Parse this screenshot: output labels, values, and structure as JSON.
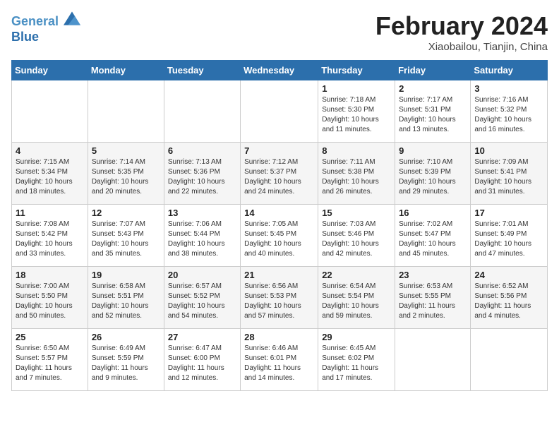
{
  "header": {
    "logo_line1": "General",
    "logo_line2": "Blue",
    "month_title": "February 2024",
    "location": "Xiaobailou, Tianjin, China"
  },
  "days_of_week": [
    "Sunday",
    "Monday",
    "Tuesday",
    "Wednesday",
    "Thursday",
    "Friday",
    "Saturday"
  ],
  "weeks": [
    [
      {
        "day": "",
        "info": ""
      },
      {
        "day": "",
        "info": ""
      },
      {
        "day": "",
        "info": ""
      },
      {
        "day": "",
        "info": ""
      },
      {
        "day": "1",
        "info": "Sunrise: 7:18 AM\nSunset: 5:30 PM\nDaylight: 10 hours\nand 11 minutes."
      },
      {
        "day": "2",
        "info": "Sunrise: 7:17 AM\nSunset: 5:31 PM\nDaylight: 10 hours\nand 13 minutes."
      },
      {
        "day": "3",
        "info": "Sunrise: 7:16 AM\nSunset: 5:32 PM\nDaylight: 10 hours\nand 16 minutes."
      }
    ],
    [
      {
        "day": "4",
        "info": "Sunrise: 7:15 AM\nSunset: 5:34 PM\nDaylight: 10 hours\nand 18 minutes."
      },
      {
        "day": "5",
        "info": "Sunrise: 7:14 AM\nSunset: 5:35 PM\nDaylight: 10 hours\nand 20 minutes."
      },
      {
        "day": "6",
        "info": "Sunrise: 7:13 AM\nSunset: 5:36 PM\nDaylight: 10 hours\nand 22 minutes."
      },
      {
        "day": "7",
        "info": "Sunrise: 7:12 AM\nSunset: 5:37 PM\nDaylight: 10 hours\nand 24 minutes."
      },
      {
        "day": "8",
        "info": "Sunrise: 7:11 AM\nSunset: 5:38 PM\nDaylight: 10 hours\nand 26 minutes."
      },
      {
        "day": "9",
        "info": "Sunrise: 7:10 AM\nSunset: 5:39 PM\nDaylight: 10 hours\nand 29 minutes."
      },
      {
        "day": "10",
        "info": "Sunrise: 7:09 AM\nSunset: 5:41 PM\nDaylight: 10 hours\nand 31 minutes."
      }
    ],
    [
      {
        "day": "11",
        "info": "Sunrise: 7:08 AM\nSunset: 5:42 PM\nDaylight: 10 hours\nand 33 minutes."
      },
      {
        "day": "12",
        "info": "Sunrise: 7:07 AM\nSunset: 5:43 PM\nDaylight: 10 hours\nand 35 minutes."
      },
      {
        "day": "13",
        "info": "Sunrise: 7:06 AM\nSunset: 5:44 PM\nDaylight: 10 hours\nand 38 minutes."
      },
      {
        "day": "14",
        "info": "Sunrise: 7:05 AM\nSunset: 5:45 PM\nDaylight: 10 hours\nand 40 minutes."
      },
      {
        "day": "15",
        "info": "Sunrise: 7:03 AM\nSunset: 5:46 PM\nDaylight: 10 hours\nand 42 minutes."
      },
      {
        "day": "16",
        "info": "Sunrise: 7:02 AM\nSunset: 5:47 PM\nDaylight: 10 hours\nand 45 minutes."
      },
      {
        "day": "17",
        "info": "Sunrise: 7:01 AM\nSunset: 5:49 PM\nDaylight: 10 hours\nand 47 minutes."
      }
    ],
    [
      {
        "day": "18",
        "info": "Sunrise: 7:00 AM\nSunset: 5:50 PM\nDaylight: 10 hours\nand 50 minutes."
      },
      {
        "day": "19",
        "info": "Sunrise: 6:58 AM\nSunset: 5:51 PM\nDaylight: 10 hours\nand 52 minutes."
      },
      {
        "day": "20",
        "info": "Sunrise: 6:57 AM\nSunset: 5:52 PM\nDaylight: 10 hours\nand 54 minutes."
      },
      {
        "day": "21",
        "info": "Sunrise: 6:56 AM\nSunset: 5:53 PM\nDaylight: 10 hours\nand 57 minutes."
      },
      {
        "day": "22",
        "info": "Sunrise: 6:54 AM\nSunset: 5:54 PM\nDaylight: 10 hours\nand 59 minutes."
      },
      {
        "day": "23",
        "info": "Sunrise: 6:53 AM\nSunset: 5:55 PM\nDaylight: 11 hours\nand 2 minutes."
      },
      {
        "day": "24",
        "info": "Sunrise: 6:52 AM\nSunset: 5:56 PM\nDaylight: 11 hours\nand 4 minutes."
      }
    ],
    [
      {
        "day": "25",
        "info": "Sunrise: 6:50 AM\nSunset: 5:57 PM\nDaylight: 11 hours\nand 7 minutes."
      },
      {
        "day": "26",
        "info": "Sunrise: 6:49 AM\nSunset: 5:59 PM\nDaylight: 11 hours\nand 9 minutes."
      },
      {
        "day": "27",
        "info": "Sunrise: 6:47 AM\nSunset: 6:00 PM\nDaylight: 11 hours\nand 12 minutes."
      },
      {
        "day": "28",
        "info": "Sunrise: 6:46 AM\nSunset: 6:01 PM\nDaylight: 11 hours\nand 14 minutes."
      },
      {
        "day": "29",
        "info": "Sunrise: 6:45 AM\nSunset: 6:02 PM\nDaylight: 11 hours\nand 17 minutes."
      },
      {
        "day": "",
        "info": ""
      },
      {
        "day": "",
        "info": ""
      }
    ]
  ]
}
